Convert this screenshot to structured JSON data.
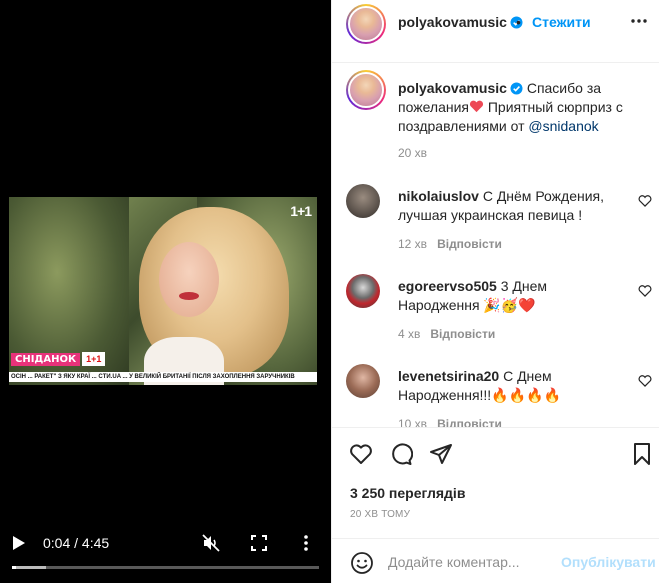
{
  "video": {
    "channel_logo": "1+1",
    "show_name": "СНІДАНОК",
    "show_channel": "1+1",
    "ticker": "ОСІН  ...  РАКЕТ\" З ЯКУ КРАЇ  ...  CTИ.UA  ...  У ВЕЛИКІЙ БРИТАНІЇ ПІСЛЯ ЗАХОПЛЕННЯ ЗАРУЧНИКІВ",
    "current_time": "0:04",
    "total_time": "4:45",
    "time_display": "0:04 / 4:45",
    "progress_fraction": 0.014,
    "buffered_fraction": 0.11
  },
  "header": {
    "username": "polyakovamusic",
    "separator": "•",
    "follow_label": "Стежити"
  },
  "caption": {
    "username": "polyakovamusic",
    "text_before_heart": "Спасибо за пожелания",
    "text_after_heart": " Приятный сюрприз с поздравлениями от ",
    "mention": "@snidanok",
    "time": "20 хв"
  },
  "comments": [
    {
      "username": "nikolaiuslov",
      "text": "С Днём Рождения, лучшая украинская певица !",
      "time": "12 хв",
      "reply_label": "Відповісти"
    },
    {
      "username": "egoreervso505",
      "text": "3 Днем Народження 🎉🥳❤️",
      "time": "4 хв",
      "reply_label": "Відповісти"
    },
    {
      "username": "levenetsirina20",
      "text": "С Днем Народження!!!🔥🔥🔥🔥",
      "time": "10 хв",
      "reply_label": "Відповісти"
    }
  ],
  "stats": {
    "views": "3 250 переглядів",
    "posted": "20 ХВ ТОМУ"
  },
  "composer": {
    "placeholder": "Додайте коментар...",
    "publish_label": "Опублікувати"
  },
  "colors": {
    "accent": "#0095f6",
    "mention": "#00376b",
    "muted": "#8e8e8e",
    "heart": "#ed4956",
    "publish_disabled": "#b2dffc"
  }
}
